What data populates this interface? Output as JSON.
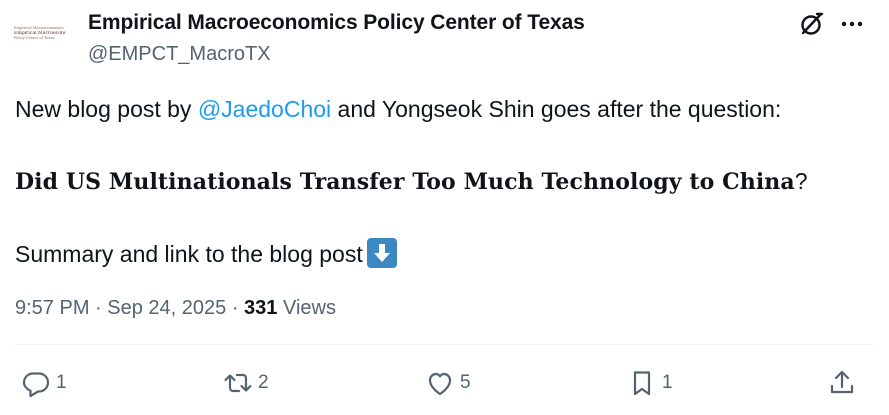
{
  "account": {
    "display_name": "Empirical Macroeconomics Policy Center of Texas",
    "handle": "@EMPCT_MacroTX",
    "logo_lines": [
      "Empirical Macroeconomics",
      "Policy Center of Texas"
    ]
  },
  "post": {
    "line1_prefix": "New blog post by ",
    "mention": "@JaedoChoi",
    "line1_suffix": " and Yongseok Shin goes after the question:",
    "headline": "Did US Multinationals Transfer Too Much Technology to China",
    "headline_punct": "?",
    "line3": "Summary and link to the blog post",
    "emoji": "down-arrow-emoji"
  },
  "meta": {
    "time": "9:57 PM",
    "separator": " · ",
    "date": "Sep 24, 2025",
    "views_count": "331",
    "views_label": " Views"
  },
  "actions": {
    "replies": "1",
    "reposts": "2",
    "likes": "5",
    "bookmarks": "1"
  },
  "icons": [
    "grok-icon",
    "more-icon",
    "reply-icon",
    "repost-icon",
    "like-icon",
    "bookmark-icon",
    "share-icon"
  ],
  "colors": {
    "text": "#0f1419",
    "secondary": "#536471",
    "link": "#1d9bf0",
    "emoji_bg": "#3b88c3"
  }
}
